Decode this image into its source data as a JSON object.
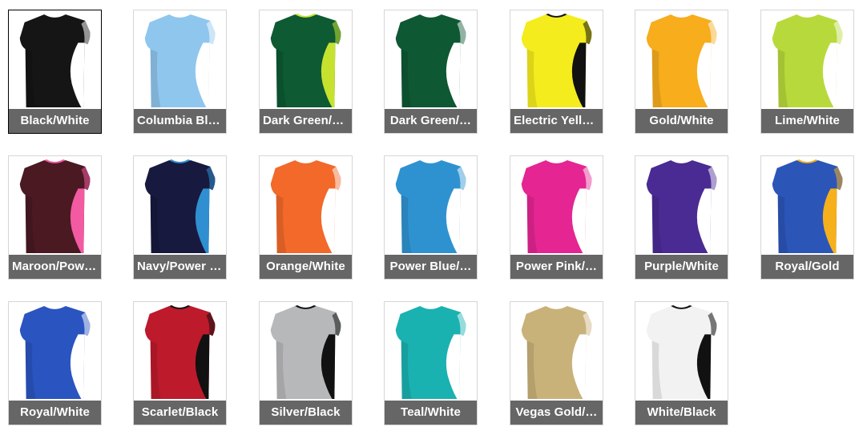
{
  "swatches": [
    {
      "label": "Black/White",
      "body": "#151515",
      "accent": "#ffffff",
      "selected": true
    },
    {
      "label": "Columbia Blu…",
      "body": "#8fc6ee",
      "accent": "#ffffff",
      "selected": false
    },
    {
      "label": "Dark Green/Li…",
      "body": "#0d5a33",
      "accent": "#c6e22e",
      "selected": false
    },
    {
      "label": "Dark Green/…",
      "body": "#0e5834",
      "accent": "#ffffff",
      "selected": false
    },
    {
      "label": "Electric Yello…",
      "body": "#f4ec1c",
      "accent": "#111111",
      "selected": false
    },
    {
      "label": "Gold/White",
      "body": "#f7ad1c",
      "accent": "#ffffff",
      "selected": false
    },
    {
      "label": "Lime/White",
      "body": "#b8d93b",
      "accent": "#ffffff",
      "selected": false
    },
    {
      "label": "Maroon/Powe…",
      "body": "#4a1922",
      "accent": "#f25aa1",
      "selected": false
    },
    {
      "label": "Navy/Power B…",
      "body": "#17193f",
      "accent": "#2f8fd0",
      "selected": false
    },
    {
      "label": "Orange/White",
      "body": "#f2692a",
      "accent": "#ffffff",
      "selected": false
    },
    {
      "label": "Power Blue/…",
      "body": "#2f92d0",
      "accent": "#ffffff",
      "selected": false
    },
    {
      "label": "Power Pink/…",
      "body": "#e42592",
      "accent": "#ffffff",
      "selected": false
    },
    {
      "label": "Purple/White",
      "body": "#4a2a93",
      "accent": "#ffffff",
      "selected": false
    },
    {
      "label": "Royal/Gold",
      "body": "#2c55b8",
      "accent": "#f5b01c",
      "selected": false
    },
    {
      "label": "Royal/White",
      "body": "#2a54c0",
      "accent": "#ffffff",
      "selected": false
    },
    {
      "label": "Scarlet/Black",
      "body": "#bd1a2c",
      "accent": "#111111",
      "selected": false
    },
    {
      "label": "Silver/Black",
      "body": "#b7b8ba",
      "accent": "#111111",
      "selected": false
    },
    {
      "label": "Teal/White",
      "body": "#1ab1b1",
      "accent": "#ffffff",
      "selected": false
    },
    {
      "label": "Vegas Gold/…",
      "body": "#c9b27a",
      "accent": "#ffffff",
      "selected": false
    },
    {
      "label": "White/Black",
      "body": "#f2f2f2",
      "accent": "#111111",
      "selected": false
    }
  ]
}
